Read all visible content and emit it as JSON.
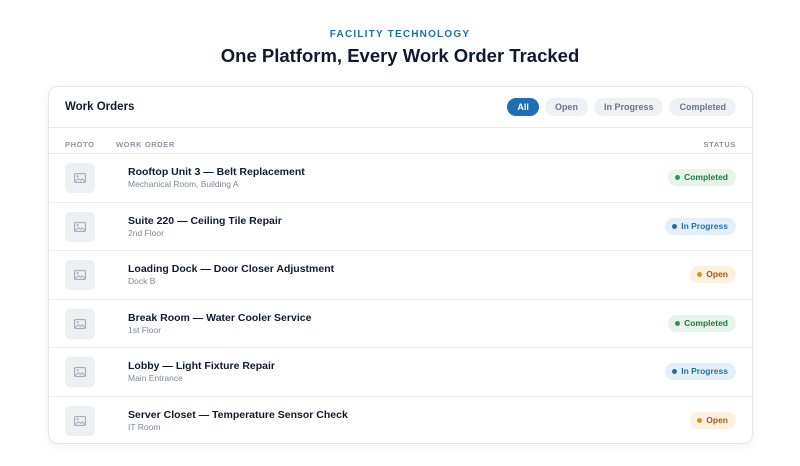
{
  "hero": {
    "eyebrow": "FACILITY TECHNOLOGY",
    "headline": "One Platform, Every Work Order Tracked"
  },
  "card": {
    "title": "Work Orders",
    "filters": [
      "All",
      "Open",
      "In Progress",
      "Completed"
    ],
    "active_filter": "All",
    "columns": {
      "photo": "PHOTO",
      "work_order": "WORK ORDER",
      "status": "STATUS"
    }
  },
  "orders": [
    {
      "title": "Rooftop Unit 3 — Belt Replacement",
      "location": "Mechanical Room, Building A",
      "status": "Completed"
    },
    {
      "title": "Suite 220 — Ceiling Tile Repair",
      "location": "2nd Floor",
      "status": "In Progress"
    },
    {
      "title": "Loading Dock — Door Closer Adjustment",
      "location": "Dock B",
      "status": "Open"
    },
    {
      "title": "Break Room — Water Cooler Service",
      "location": "1st Floor",
      "status": "Completed"
    },
    {
      "title": "Lobby — Light Fixture Repair",
      "location": "Main Entrance",
      "status": "In Progress"
    },
    {
      "title": "Server Closet — Temperature Sensor Check",
      "location": "IT Room",
      "status": "Open"
    }
  ],
  "icons": {
    "thumbnail": "image-placeholder-icon",
    "status_marker": "status-dot-icon"
  },
  "colors": {
    "accent": "#1f6fb2",
    "completed": "#1e7a3c",
    "in_progress": "#1f6fb2",
    "open": "#a35a07"
  }
}
